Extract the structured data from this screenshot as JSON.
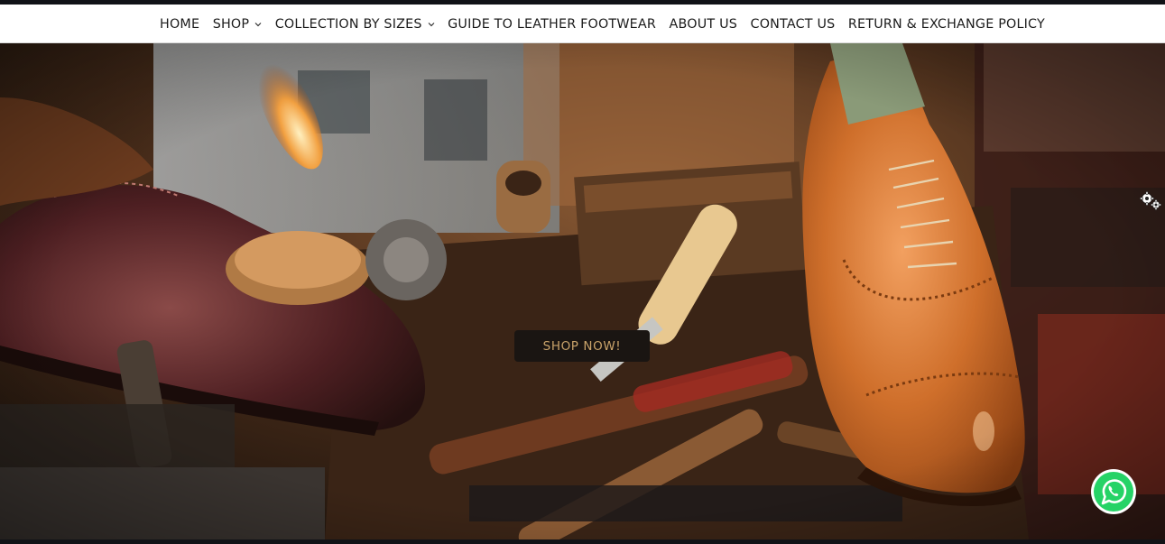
{
  "nav": {
    "items": [
      {
        "label": "HOME",
        "dropdown": false
      },
      {
        "label": "SHOP",
        "dropdown": true
      },
      {
        "label": "COLLECTION BY SIZES",
        "dropdown": true
      },
      {
        "label": "GUIDE TO LEATHER FOOTWEAR",
        "dropdown": false
      },
      {
        "label": "ABOUT US",
        "dropdown": false
      },
      {
        "label": "CONTACT US",
        "dropdown": false
      },
      {
        "label": "RETURN & EXCHANGE POLICY",
        "dropdown": false
      }
    ]
  },
  "hero": {
    "cta_label": "SHOP NOW!"
  },
  "widgets": {
    "settings_icon": "gears-icon",
    "chat_icon": "whatsapp-icon"
  },
  "colors": {
    "cta_text": "#c9a36a",
    "cta_bg": "#1a1512",
    "whatsapp": "#25d366"
  }
}
